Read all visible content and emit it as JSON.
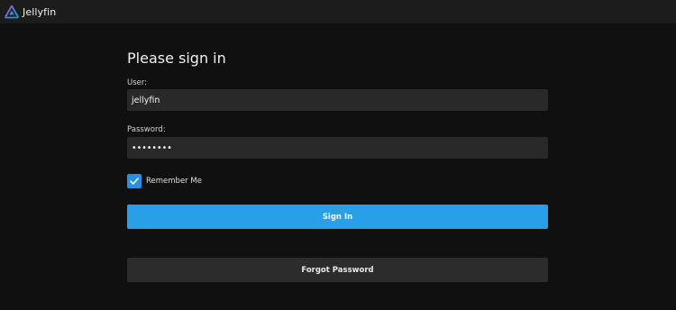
{
  "header": {
    "app_name": "Jellyfin",
    "logo_icon": "jellyfin-logo-icon"
  },
  "form": {
    "title": "Please sign in",
    "user_label": "User:",
    "user_value": "jellyfin",
    "password_label": "Password:",
    "password_value": "••••••••",
    "remember_label": "Remember Me",
    "remember_checked": true,
    "check_icon": "checkmark-icon",
    "signin_label": "Sign In",
    "forgot_label": "Forgot Password"
  },
  "colors": {
    "accent": "#27a0e8",
    "background": "#101010",
    "header_bg": "#1c1c1c",
    "input_bg": "#292929",
    "secondary_button": "#2c2c2c",
    "logo_purple": "#aa5cc3",
    "logo_blue": "#00a4dc"
  }
}
